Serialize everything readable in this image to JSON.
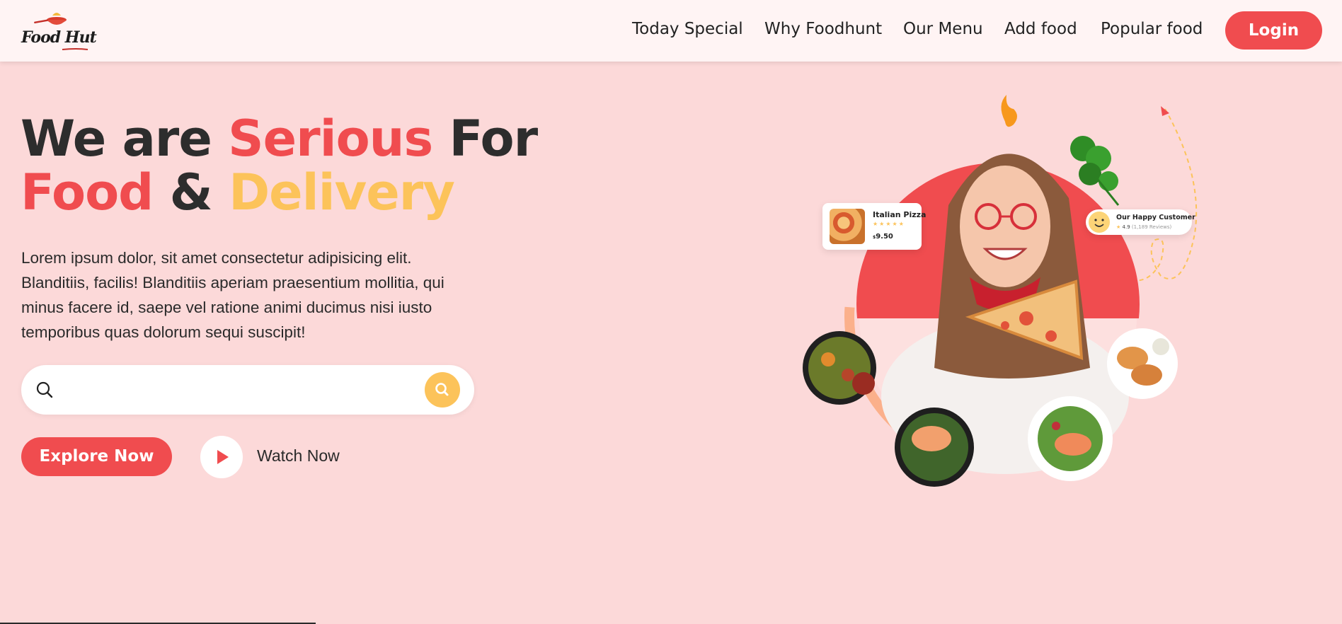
{
  "brand": {
    "logo_text": "Food Hut"
  },
  "nav": {
    "links": [
      {
        "label": "Today Special"
      },
      {
        "label": "Why Foodhunt"
      },
      {
        "label": "Our Menu"
      },
      {
        "label": "Add food"
      },
      {
        "label": "Popular food"
      }
    ],
    "login_label": "Login"
  },
  "hero": {
    "title_parts": {
      "we_are": "We are",
      "serious": "Serious",
      "for": "For",
      "food": "Food",
      "amp": "&",
      "delivery": "Delivery"
    },
    "description": "Lorem ipsum dolor, sit amet consectetur adipisicing elit. Blanditiis, facilis! Blanditiis aperiam praesentium mollitia, qui minus facere id, saepe vel ratione animi ducimus nisi iusto temporibus quas dolorum sequi suscipit!",
    "search": {
      "value": "",
      "placeholder": ""
    },
    "explore_label": "Explore Now",
    "watch_label": "Watch Now"
  },
  "illustration": {
    "pizza_card": {
      "name": "Italian Pizza",
      "stars": "★★★★★",
      "currency": "$",
      "price": "9.50"
    },
    "customer_card": {
      "title": "Our Happy Customer",
      "star": "★",
      "rating": "4.9",
      "reviews": "(1,189 Reviews)"
    }
  },
  "colors": {
    "accent_red": "#f04c4f",
    "accent_yellow": "#fcc35a",
    "background": "#fcd9d9",
    "navbar": "#fff4f4"
  },
  "icons": [
    "logo-pan-icon",
    "search-icon",
    "search-button-icon",
    "play-icon",
    "flame-icon",
    "parsley-icon",
    "smiley-icon",
    "star-icon",
    "arrow-icon"
  ]
}
